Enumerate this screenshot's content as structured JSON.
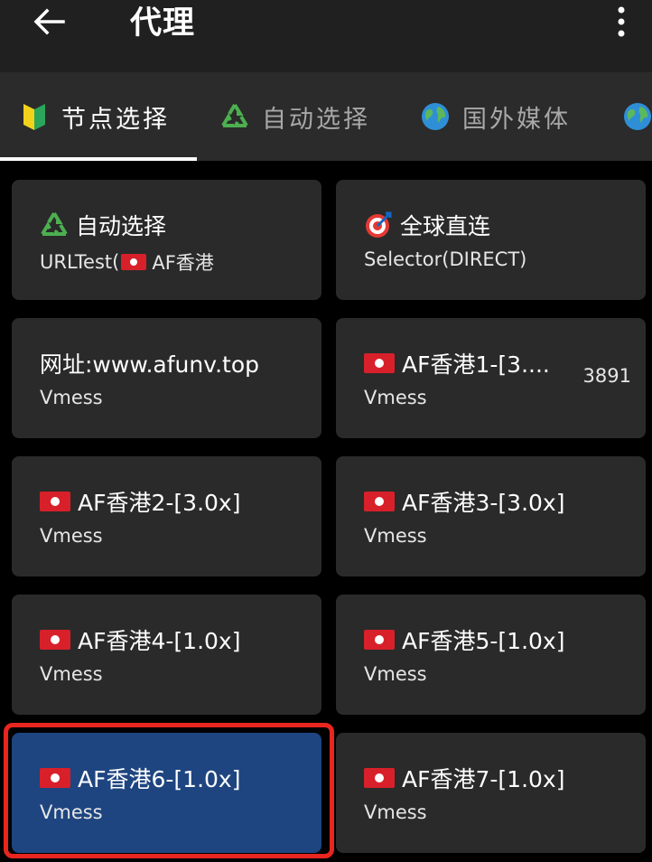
{
  "appbar": {
    "title": "代理",
    "back_icon": "arrow-left-icon",
    "more_icon": "more-vertical-icon"
  },
  "tabs": [
    {
      "label": "节点选择",
      "icon": "beginner-shield-icon",
      "active": true
    },
    {
      "label": "自动选择",
      "icon": "recycle-icon",
      "active": false
    },
    {
      "label": "国外媒体",
      "icon": "globe-icon",
      "active": false
    },
    {
      "label": "",
      "icon": "globe-icon",
      "active": false
    }
  ],
  "proxies": [
    {
      "name": "自动选择",
      "type": "URLTest(",
      "type_suffix": "AF香港",
      "icon": "recycle-icon",
      "delay": ""
    },
    {
      "name": "全球直连",
      "type": "Selector(DIRECT)",
      "icon": "target-icon",
      "delay": ""
    },
    {
      "name": "网址:www.afunv.top",
      "type": "Vmess",
      "icon": "",
      "delay": ""
    },
    {
      "name": "AF香港1-[3....",
      "type": "Vmess",
      "icon": "hk-flag-icon",
      "delay": "3891"
    },
    {
      "name": "AF香港2-[3.0x]",
      "type": "Vmess",
      "icon": "hk-flag-icon",
      "delay": ""
    },
    {
      "name": "AF香港3-[3.0x]",
      "type": "Vmess",
      "icon": "hk-flag-icon",
      "delay": ""
    },
    {
      "name": "AF香港4-[1.0x]",
      "type": "Vmess",
      "icon": "hk-flag-icon",
      "delay": ""
    },
    {
      "name": "AF香港5-[1.0x]",
      "type": "Vmess",
      "icon": "hk-flag-icon",
      "delay": ""
    },
    {
      "name": "AF香港6-[1.0x]",
      "type": "Vmess",
      "icon": "hk-flag-icon",
      "delay": "",
      "selected": true
    },
    {
      "name": "AF香港7-[1.0x]",
      "type": "Vmess",
      "icon": "hk-flag-icon",
      "delay": ""
    }
  ],
  "colors": {
    "selected_card": "#1e4580",
    "card": "#2a2a2a",
    "highlight_border": "#e8261f"
  }
}
